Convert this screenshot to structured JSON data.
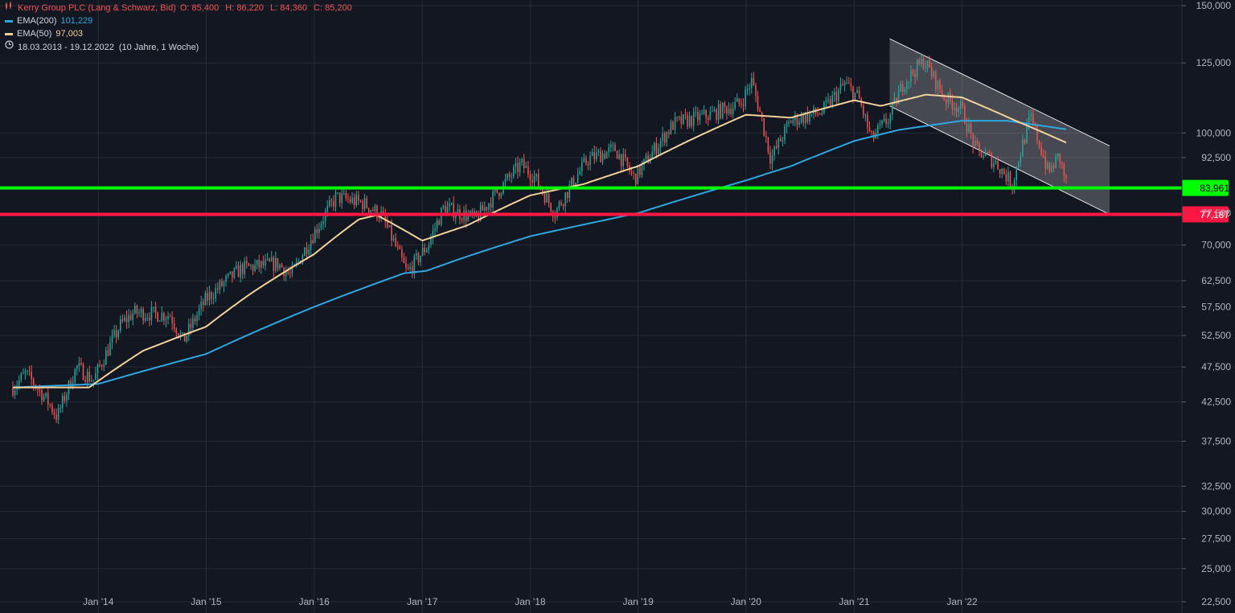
{
  "legend": {
    "instrument": "Kerry Group PLC (Lang & Schwarz, Bid)",
    "ohlc": {
      "o_label": "O:",
      "o": "85,400",
      "h_label": "H:",
      "h": "86,220",
      "l_label": "L:",
      "l": "84,360",
      "c_label": "C:",
      "c": "85,200"
    },
    "ema200": {
      "label": "EMA(200)",
      "value": "101,229",
      "color": "#2ea7e0"
    },
    "ema50": {
      "label": "EMA(50)",
      "value": "97,003",
      "color": "#f3d19a"
    },
    "range": {
      "text": "18.03.2013 - 19.12.2022",
      "detail": "(10 Jahre, 1 Woche)"
    },
    "icons": [
      "candlestick-icon",
      "clock-icon"
    ]
  },
  "colors": {
    "background": "#131722",
    "up": "#26a69a",
    "down": "#ef5350",
    "support_green": "#00ff00",
    "support_red": "#ff1744",
    "grid": "#262b36",
    "axis_text": "#b2b5be"
  },
  "chart_data": {
    "type": "candlestick",
    "title": "Kerry Group PLC (Lang & Schwarz, Bid)",
    "y_scale": "log",
    "ylim": [
      22500,
      150000
    ],
    "y_ticks": [
      "150,000",
      "125,000",
      "100,000",
      "92,500",
      "77,500",
      "70,000",
      "62,500",
      "57,500",
      "52,500",
      "47,500",
      "42,500",
      "37,500",
      "32,500",
      "30,000",
      "27,500",
      "25,000",
      "22,500"
    ],
    "x_ticks": [
      "Jan '14",
      "Jan '15",
      "Jan '16",
      "Jan '17",
      "Jan '18",
      "Jan '19",
      "Jan '20",
      "Jan '21",
      "Jan '22"
    ],
    "x_range": [
      "2013-03-18",
      "2023-06-30"
    ],
    "price_anchors": [
      [
        "2013-03-18",
        44.5
      ],
      [
        "2013-05-01",
        46.5
      ],
      [
        "2013-07-15",
        42.5
      ],
      [
        "2013-08-15",
        40.5
      ],
      [
        "2013-10-20",
        47.5
      ],
      [
        "2013-12-15",
        45.5
      ],
      [
        "2014-03-20",
        54.5
      ],
      [
        "2014-05-01",
        56.5
      ],
      [
        "2014-09-01",
        56.0
      ],
      [
        "2014-10-15",
        51.5
      ],
      [
        "2015-01-01",
        59.0
      ],
      [
        "2015-05-01",
        65.0
      ],
      [
        "2015-09-01",
        66.0
      ],
      [
        "2015-10-15",
        63.5
      ],
      [
        "2016-03-15",
        81.5
      ],
      [
        "2016-06-15",
        80.0
      ],
      [
        "2016-08-15",
        77.0
      ],
      [
        "2016-11-10",
        64.0
      ],
      [
        "2017-01-20",
        70.0
      ],
      [
        "2017-03-15",
        79.0
      ],
      [
        "2017-07-01",
        76.0
      ],
      [
        "2017-12-01",
        90.5
      ],
      [
        "2018-01-15",
        87.0
      ],
      [
        "2018-03-25",
        77.5
      ],
      [
        "2018-07-15",
        92.0
      ],
      [
        "2018-10-15",
        95.0
      ],
      [
        "2018-12-20",
        86.5
      ],
      [
        "2019-05-01",
        103.0
      ],
      [
        "2019-09-01",
        106.0
      ],
      [
        "2019-12-15",
        110.0
      ],
      [
        "2020-01-20",
        118.0
      ],
      [
        "2020-03-25",
        92.0
      ],
      [
        "2020-06-01",
        104.0
      ],
      [
        "2020-09-15",
        107.0
      ],
      [
        "2020-12-01",
        117.0
      ],
      [
        "2021-01-15",
        112.0
      ],
      [
        "2021-02-28",
        98.0
      ],
      [
        "2021-05-01",
        105.0
      ],
      [
        "2021-06-15",
        117.0
      ],
      [
        "2021-08-25",
        126.0
      ],
      [
        "2021-11-01",
        112.0
      ],
      [
        "2021-12-30",
        108.0
      ],
      [
        "2022-02-15",
        95.0
      ],
      [
        "2022-04-25",
        91.0
      ],
      [
        "2022-06-20",
        85.0
      ],
      [
        "2022-08-20",
        105.0
      ],
      [
        "2022-10-20",
        88.0
      ],
      [
        "2022-11-25",
        93.0
      ],
      [
        "2022-12-19",
        85.2
      ]
    ],
    "ema200_anchors": [
      [
        "2013-03-18",
        44.5
      ],
      [
        "2014-01-01",
        45.0
      ],
      [
        "2015-01-01",
        49.5
      ],
      [
        "2016-01-01",
        57.5
      ],
      [
        "2016-11-01",
        64.0
      ],
      [
        "2017-01-15",
        64.5
      ],
      [
        "2017-06-01",
        67.5
      ],
      [
        "2018-01-01",
        72.0
      ],
      [
        "2019-01-01",
        77.5
      ],
      [
        "2020-01-01",
        86.0
      ],
      [
        "2020-06-01",
        90.0
      ],
      [
        "2021-01-01",
        97.5
      ],
      [
        "2021-06-01",
        101.0
      ],
      [
        "2022-01-01",
        104.0
      ],
      [
        "2022-06-01",
        104.0
      ],
      [
        "2022-12-19",
        101.2
      ]
    ],
    "ema50_anchors": [
      [
        "2013-03-18",
        44.5
      ],
      [
        "2013-12-01",
        44.5
      ],
      [
        "2014-06-01",
        50.0
      ],
      [
        "2015-01-01",
        54.0
      ],
      [
        "2015-06-01",
        60.0
      ],
      [
        "2016-01-01",
        68.0
      ],
      [
        "2016-06-01",
        76.0
      ],
      [
        "2016-08-01",
        77.0
      ],
      [
        "2017-01-01",
        71.0
      ],
      [
        "2017-06-01",
        74.5
      ],
      [
        "2018-01-01",
        82.0
      ],
      [
        "2018-07-01",
        85.0
      ],
      [
        "2019-01-01",
        90.0
      ],
      [
        "2019-07-01",
        98.0
      ],
      [
        "2020-01-01",
        106.0
      ],
      [
        "2020-06-01",
        105.0
      ],
      [
        "2021-01-01",
        111.0
      ],
      [
        "2021-04-01",
        109.0
      ],
      [
        "2021-09-01",
        113.0
      ],
      [
        "2022-01-01",
        112.0
      ],
      [
        "2022-07-01",
        104.0
      ],
      [
        "2022-12-19",
        97.0
      ]
    ],
    "horizontal_levels": [
      {
        "value": 83.961,
        "label": "83,961",
        "color": "#00ff00"
      },
      {
        "value": 77.187,
        "label": "77,187",
        "color": "#ff1744"
      }
    ],
    "channel": {
      "upper": [
        [
          "2021-05-01",
          135.0
        ],
        [
          "2023-05-15",
          96.0
        ]
      ],
      "lower": [
        [
          "2021-05-01",
          109.0
        ],
        [
          "2023-05-15",
          77.187
        ]
      ]
    },
    "grid": true
  }
}
